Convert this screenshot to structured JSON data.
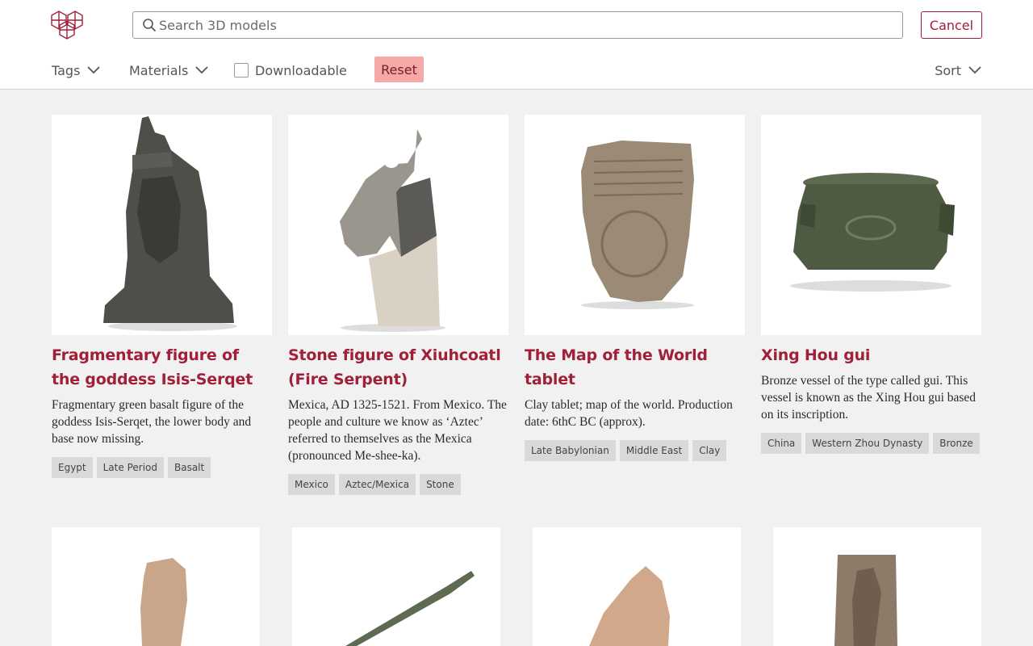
{
  "header": {
    "logo_icon": "museum-logo-icon",
    "search": {
      "placeholder": "Search 3D models",
      "value": ""
    },
    "cancel_label": "Cancel"
  },
  "filters": {
    "tags_label": "Tags",
    "materials_label": "Materials",
    "downloadable_label": "Downloadable",
    "downloadable_checked": false,
    "reset_label": "Reset",
    "sort_label": "Sort"
  },
  "colors": {
    "accent": "#a0203a",
    "reset_bg": "#f4a9a6",
    "page_bg": "#f1f1f1",
    "tag_bg": "#d9d9d9"
  },
  "cards": [
    {
      "title": "Fragmentary figure of the goddess Isis-Serqet",
      "description": "Fragmentary green basalt figure of the goddess Isis-Serqet, the lower body and base now missing.",
      "tags": [
        "Egypt",
        "Late Period",
        "Basalt"
      ]
    },
    {
      "title": "Stone figure of Xiuhcoatl (Fire Serpent)",
      "description": "Mexica, AD 1325-1521. From Mexico. The people and culture we know as ‘Aztec’ referred to themselves as the Mexica (pronounced Me-shee-ka).",
      "tags": [
        "Mexico",
        "Aztec/Mexica",
        "Stone"
      ]
    },
    {
      "title": "The Map of the World tablet",
      "description": "Clay tablet; map of the world. Production date: 6thC BC (approx).",
      "tags": [
        "Late Babylonian",
        "Middle East",
        "Clay"
      ]
    },
    {
      "title": "Xing Hou gui",
      "description": "Bronze vessel of the type called gui. This vessel is known as the Xing Hou gui based on its inscription.",
      "tags": [
        "China",
        "Western Zhou Dynasty",
        "Bronze"
      ]
    }
  ]
}
